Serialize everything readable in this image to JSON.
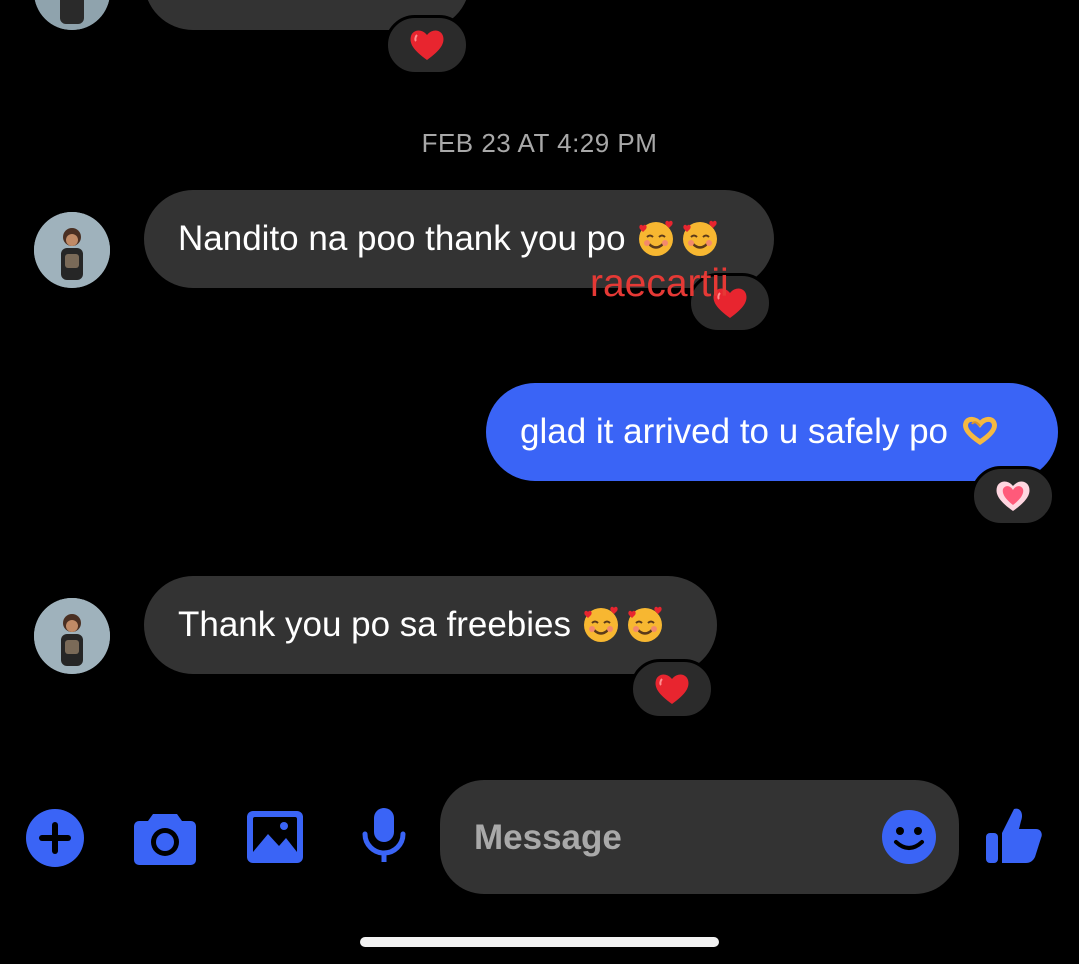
{
  "colors": {
    "background": "#000000",
    "incoming_bubble": "#333333",
    "outgoing_bubble": "#3a64f6",
    "accent": "#3a64f6",
    "timestamp": "#a8a8a8",
    "watermark": "#e53935"
  },
  "conversation": {
    "timestamp": "FEB 23 AT 4:29 PM",
    "messages": [
      {
        "direction": "incoming",
        "text": "Nandito na poo thank you po",
        "emoji": [
          "smiling-face-with-hearts",
          "smiling-face-with-hearts"
        ],
        "reaction": "red-heart"
      },
      {
        "direction": "outgoing",
        "text": "glad it arrived to u safely po",
        "emoji": [
          "heart-hands"
        ],
        "reaction": "growing-heart"
      },
      {
        "direction": "incoming",
        "text": "Thank you po sa freebies",
        "emoji": [
          "smiling-face-with-hearts",
          "smiling-face-with-hearts"
        ],
        "reaction": "red-heart"
      }
    ],
    "previous_message_reaction": "red-heart"
  },
  "watermark": "raecartii",
  "composer": {
    "placeholder": "Message",
    "icons": [
      "plus-icon",
      "camera-icon",
      "gallery-icon",
      "microphone-icon",
      "emoji-icon",
      "thumbs-up-icon"
    ]
  }
}
